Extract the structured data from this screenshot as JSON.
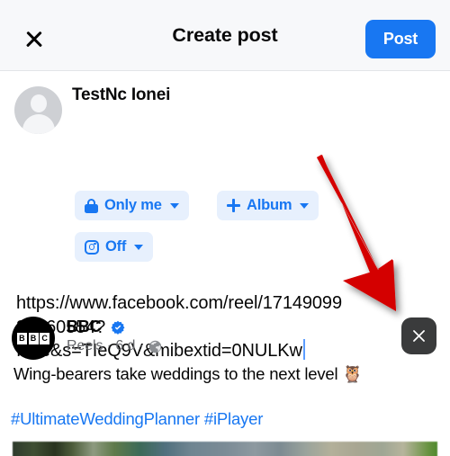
{
  "header": {
    "close_icon": "close-icon",
    "title": "Create post",
    "post_label": "Post"
  },
  "composer": {
    "avatar_icon": "default-user-avatar",
    "user_name": "TestNc Ionei",
    "chips": [
      {
        "icon": "lock-icon",
        "label": "Only me",
        "caret": "chevron-down-icon"
      },
      {
        "icon": "plus-icon",
        "label": "Album",
        "caret": "chevron-down-icon"
      },
      {
        "icon": "instagram-icon",
        "label": "Off",
        "caret": "chevron-down-icon"
      }
    ],
    "post_text": "https://www.facebook.com/reel/1714909932360554?fs=e&s=TIeQ9V&mibextid=0NULKw"
  },
  "link_preview": {
    "source_avatar": "bbc-logo",
    "source_letters": [
      "B",
      "B",
      "C"
    ],
    "source_name": "BBC",
    "verified_icon": "verified-badge-icon",
    "meta": "Reels · 6 d ·",
    "audience_icon": "globe-icon",
    "body_text": "Wing-bearers take weddings to the next level 🦉",
    "hashtags": "#UltimateWeddingPlanner #iPlayer",
    "remove_icon": "close-icon"
  },
  "annotation": {
    "arrow_color": "#d40000",
    "arrow_label": "red-pointer-arrow"
  },
  "colors": {
    "accent_blue": "#1877f2",
    "chip_bg": "#e7f0fd",
    "header_bg": "#f7f8fa",
    "text_primary": "#050505",
    "text_secondary": "#65676b"
  }
}
